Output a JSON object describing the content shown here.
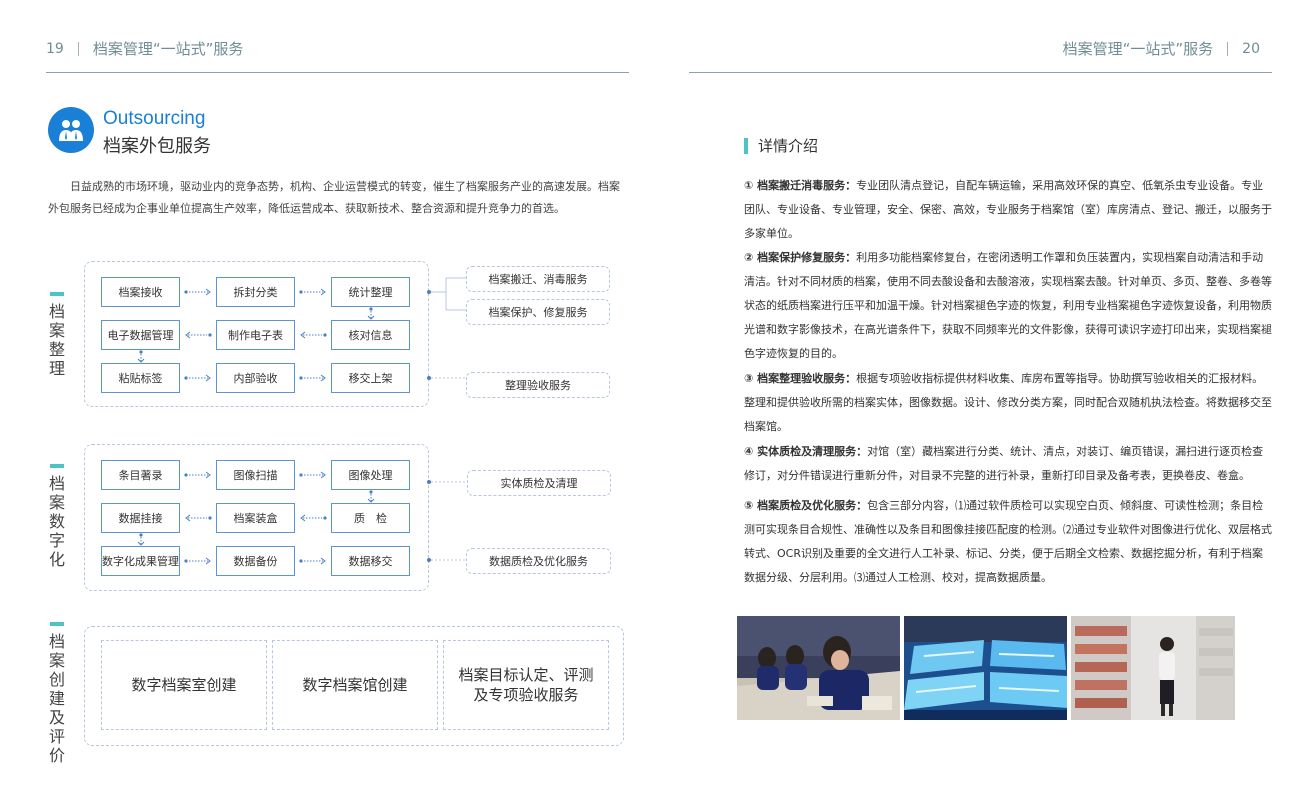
{
  "header": {
    "left_page_num": "19",
    "right_page_num": "20",
    "title": "档案管理“一站式”服务"
  },
  "section": {
    "title_en": "Outsourcing",
    "title_cn": "档案外包服务",
    "icon": "business-people-icon",
    "intro": "日益成熟的市场环境，驱动业内的竞争态势，机构、企业运营模式的转变，催生了档案服务产业的高速发展。档案外包服务已经成为企事业单位提高生产效率，降低运营成本、获取新技术、整合资源和提升竞争力的首选。"
  },
  "flow1": {
    "label": "档案整理",
    "boxes": [
      "档案接收",
      "拆封分类",
      "统计整理",
      "电子数据管理",
      "制作电子表",
      "核对信息",
      "粘贴标签",
      "内部验收",
      "移交上架"
    ],
    "services": [
      "档案搬迁、消毒服务",
      "档案保护、修复服务",
      "整理验收服务"
    ]
  },
  "flow2": {
    "label": "档案数字化",
    "boxes": [
      "条目著录",
      "图像扫描",
      "图像处理",
      "数据挂接",
      "档案装盒",
      "质　检",
      "数字化成果管理",
      "数据备份",
      "数据移交"
    ],
    "services": [
      "实体质检及清理",
      "数据质检及优化服务"
    ]
  },
  "flow3": {
    "label": "档案创建及评价",
    "items": [
      "数字档案室创建",
      "数字档案馆创建",
      "档案目标认定、评测及专项验收服务"
    ]
  },
  "details": {
    "title": "详情介绍",
    "items": [
      {
        "title": "① 档案搬迁消毒服务：",
        "text": "专业团队清点登记，自配车辆运输，采用高效环保的真空、低氧杀虫专业设备。专业团队、专业设备、专业管理，安全、保密、高效，专业服务于档案馆（室）库房清点、登记、搬迁，以服务于多家单位。"
      },
      {
        "title": "② 档案保护修复服务：",
        "text": "利用多功能档案修复台，在密闭透明工作罩和负压装置内，实现档案自动清洁和手动清洁。针对不同材质的档案，使用不同去酸设备和去酸溶液，实现档案去酸。针对单页、多页、整卷、多卷等状态的纸质档案进行压平和加温干燥。针对档案褪色字迹的恢复，利用专业档案褪色字迹恢复设备，利用物质光谱和数字影像技术，在高光谱条件下，获取不同频率光的文件影像，获得可读识字迹打印出来，实现档案褪色字迹恢复的目的。"
      },
      {
        "title": "③ 档案整理验收服务：",
        "text": "根据专项验收指标提供材料收集、库房布置等指导。协助撰写验收相关的汇报材料。整理和提供验收所需的档案实体，图像数据。设计、修改分类方案，同时配合双随机执法检查。将数据移交至档案馆。"
      },
      {
        "title": "④ 实体质检及清理服务：",
        "text": "对馆（室）藏档案进行分类、统计、清点，对装订、编页错误，漏扫进行逐页检查修订，对分件错误进行重新分件，对目录不完整的进行补录，重新打印目录及备考表，更换卷皮、卷盒。"
      },
      {
        "title": "⑤ 档案质检及优化服务：",
        "text": "包含三部分内容，⑴通过软件质检可以实现空白页、倾斜度、可读性检测；条目检测可实现条目合规性、准确性以及条目和图像挂接匹配度的检测。⑵通过专业软件对图像进行优化、双层格式转式、OCR识别及重要的全文进行人工补录、标记、分类，便于后期全文检索、数据挖掘分析，有利于档案数据分级、分层利用。⑶通过人工检测、校对，提高数据质量。"
      }
    ]
  },
  "photos": [
    "workers-repairing-archives-photo",
    "blue-light-scanning-equipment-photo",
    "archive-shelves-staff-photo"
  ],
  "colors": {
    "accent": "#1a7fd6",
    "teal": "#4cc3c4",
    "box_border": "#5b95d6"
  }
}
